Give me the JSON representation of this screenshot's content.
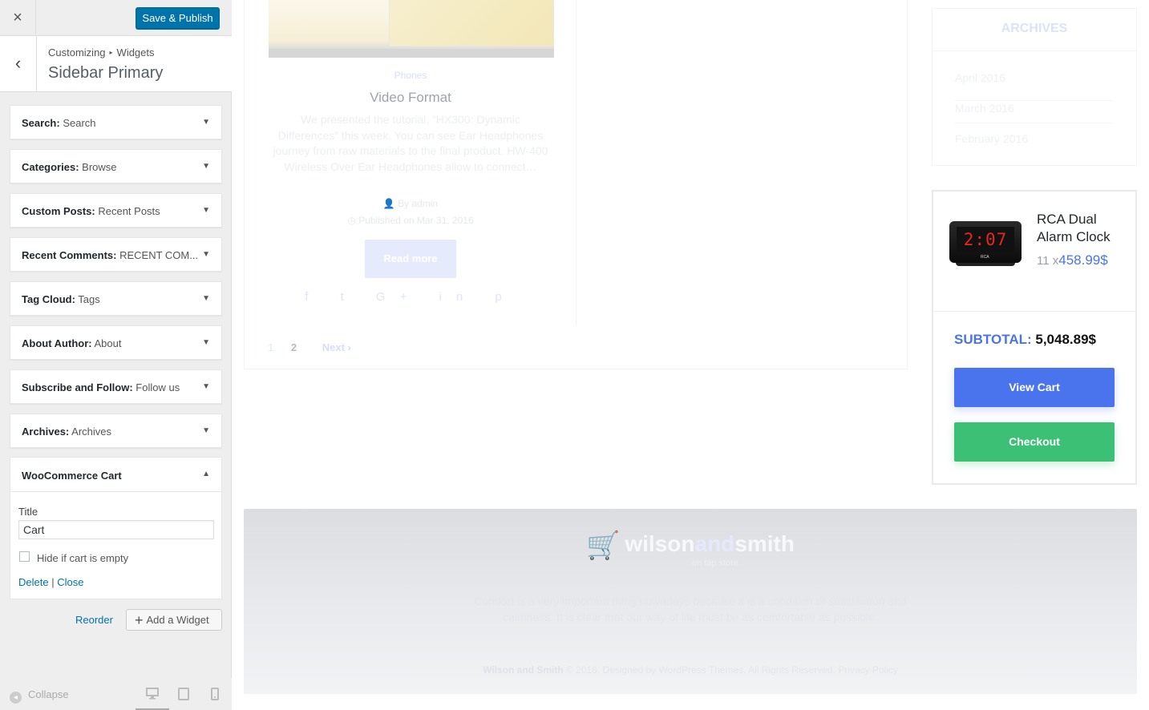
{
  "customizer": {
    "close_icon": "×",
    "save_label": "Save & Publish",
    "back_icon": "‹",
    "breadcrumb": {
      "root": "Customizing",
      "sep": "▸",
      "section": "Widgets"
    },
    "section_title": "Sidebar Primary",
    "widgets": [
      {
        "type": "Search:",
        "instance": " Search"
      },
      {
        "type": "Categories:",
        "instance": " Browse"
      },
      {
        "type": "Custom Posts:",
        "instance": " Recent Posts"
      },
      {
        "type": "Recent Comments:",
        "instance": " RECENT COM..."
      },
      {
        "type": "Tag Cloud:",
        "instance": " Tags"
      },
      {
        "type": "About Author:",
        "instance": " About"
      },
      {
        "type": "Subscribe and Follow:",
        "instance": " Follow us"
      },
      {
        "type": "Archives:",
        "instance": " Archives"
      }
    ],
    "expanded_widget": {
      "title": "WooCommerce Cart",
      "title_label": "Title",
      "title_value": "Cart",
      "hide_label": "Hide if cart is empty",
      "hide_checked": false,
      "delete_label": "Delete",
      "divider": "|",
      "close_label": "Close"
    },
    "arrow_down": "▼",
    "arrow_up": "▲",
    "reorder_label": "Reorder",
    "add_widget_label": "Add a Widget",
    "add_icon": "+",
    "collapse_label": "Collapse",
    "collapse_icon": "◂",
    "devices": [
      "desktop-icon",
      "tablet-icon",
      "mobile-icon"
    ]
  },
  "preview": {
    "post": {
      "category": "Phones",
      "title": "Video Format",
      "excerpt": "We presented the tutorial, “HX300: Dynamic Differences” this week. You can see Ear Headphones journey from raw materials to the final product. HW-400 Wireless Over Ear Headphones allow to connect…",
      "author": "By admin",
      "date": "Published on Mar 31, 2016",
      "read_more": "Read more",
      "share_icons": "f  t  G+  in  p"
    },
    "pagination": {
      "page1": "1",
      "page2": "2",
      "next": "Next ›"
    },
    "archives": {
      "title": "ARCHIVES",
      "items": [
        "April 2016",
        "March 2016",
        "February 2016"
      ]
    },
    "cart": {
      "product_name": "RCA Dual Alarm Clock",
      "qty": "11 x",
      "price": "458.99$",
      "clock_display": "2:07",
      "clock_logo": "RCA",
      "subtotal_label": "SUBTOTAL:",
      "subtotal_value": "5,048.89$",
      "view_cart": "View Cart",
      "checkout": "Checkout"
    },
    "footer": {
      "brand_a": "wilson",
      "brand_b": "and",
      "brand_c": "smith",
      "tagline": "on tap store",
      "text": "Comfort is a very important thing nowadays because it is a condition of satisfaction and calmness. It is clear that our way of life must be as comfortable as possible.",
      "copy_brand": "Wilson and Smith",
      "copy_rest": " © 2016. Designed by WordPress Themes. All Rights Reserved. Privacy Policy"
    },
    "colors": {
      "accent_blue": "#4a74ed",
      "checkout_green": "#3cc075",
      "wp_blue": "#0073aa"
    }
  }
}
